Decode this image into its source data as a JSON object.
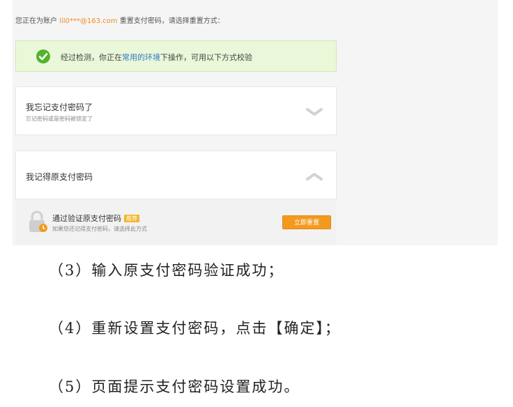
{
  "account_line": {
    "prefix": "您正在为账户 ",
    "account": "lil0***@163.com",
    "suffix": " 重置支付密码，请选择重置方式："
  },
  "notice": {
    "before": "经过检测，你正在",
    "link": "常用的环境",
    "after": "下操作，可用以下方式校验",
    "icon": "check-circle-icon",
    "color": "#54b22e"
  },
  "options": {
    "forgot": {
      "title": "我忘记支付密码了",
      "subtitle": "忘记密码或是密码被锁定了",
      "icon": "chevron-down-icon"
    },
    "remember": {
      "title": "我记得原支付密码",
      "icon": "chevron-up-icon"
    },
    "verify": {
      "title": "通过验证原支付密码",
      "badge": "推荐",
      "subtitle": "如果您还记得支付密码，请选择此方式",
      "button": "立即重置",
      "icon": "lock-icon",
      "accent": "#f39a1e"
    }
  },
  "steps": [
    "（3）输入原支付密码验证成功；",
    "（4）重新设置支付密码，点击【确定】；",
    "（5）页面提示支付密码设置成功。"
  ]
}
